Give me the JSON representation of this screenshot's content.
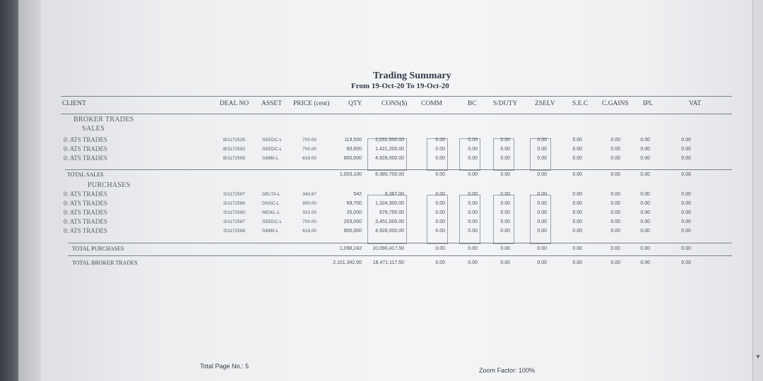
{
  "report": {
    "title": "Trading Summary",
    "subtitle": "From  19-Oct-20    To  19-Oct-20"
  },
  "columns": [
    "CLIENT",
    "DEAL NO",
    "ASSET",
    "PRICE (cent)",
    "QTY",
    "CONS($)",
    "COMM",
    "BC",
    "S/DUTY",
    "ZSELV",
    "S.E.C",
    "C.GAINS",
    "IPL",
    "VAT"
  ],
  "sections": {
    "broker": "BROKER TRADES",
    "sales": "SALES",
    "purchases": "PURCHASES",
    "total_sales": "TOTAL SALES",
    "total_purchases": "TOTAL PURCHASES",
    "total_broker": "TOTAL BROKER TRADES"
  },
  "sales_rows": [
    {
      "client": "0: ATS TRADES",
      "deal": "B/1172535",
      "asset": "SEEDC-L",
      "price": "700.00",
      "qty": "119,500",
      "cons": "2,031,500.00",
      "comm": "0.00",
      "bc": "0.00",
      "duty": "0.00",
      "zselv": "0.00",
      "sec": "0.00",
      "cg": "0.00",
      "ipl": "0.00",
      "vat": "0.00"
    },
    {
      "client": "0: ATS TRADES",
      "deal": "B/1172593",
      "asset": "SEEDC-L",
      "price": "700.00",
      "qty": "83,600",
      "cons": "1,421,200.00",
      "comm": "0.00",
      "bc": "0.00",
      "duty": "0.00",
      "zselv": "0.00",
      "sec": "0.00",
      "cg": "0.00",
      "ipl": "0.00",
      "vat": "0.00"
    },
    {
      "client": "0: ATS TRADES",
      "deal": "B/1172595",
      "asset": "SIMBI-L",
      "price": "616.00",
      "qty": "800,000",
      "cons": "4,928,000.00",
      "comm": "0.00",
      "bc": "0.00",
      "duty": "0.00",
      "zselv": "0.00",
      "sec": "0.00",
      "cg": "0.00",
      "ipl": "0.00",
      "vat": "0.00"
    }
  ],
  "total_sales_row": {
    "qty": "1,003,100",
    "cons": "8,380,700.00",
    "comm": "0.00",
    "bc": "0.00",
    "duty": "0.00",
    "zselv": "0.00",
    "sec": "0.00",
    "cg": "0.00",
    "ipl": "0.00",
    "vat": "0.00"
  },
  "purchase_rows": [
    {
      "client": "0: ATS TRADES",
      "deal": "S/1172597",
      "asset": "DELTA-L",
      "price": "343.87",
      "qty": "542",
      "cons": "8,367.00",
      "comm": "0.00",
      "bc": "0.00",
      "duty": "0.00",
      "zselv": "0.00",
      "sec": "0.00",
      "cg": "0.00",
      "ipl": "0.00",
      "vat": "0.00"
    },
    {
      "client": "0: ATS TRADES",
      "deal": "S/1172586",
      "asset": "DNSC-L",
      "price": "900.00",
      "qty": "69,700",
      "cons": "1,324,300.00",
      "comm": "0.00",
      "bc": "0.00",
      "duty": "0.00",
      "zselv": "0.00",
      "sec": "0.00",
      "cg": "0.00",
      "ipl": "0.00",
      "vat": "0.00"
    },
    {
      "client": "0: ATS TRADES",
      "deal": "S/1172590",
      "asset": "MEIKL-L",
      "price": "315.00",
      "qty": "25,000",
      "cons": "878,750.00",
      "comm": "0.00",
      "bc": "0.00",
      "duty": "0.00",
      "zselv": "0.00",
      "sec": "0.00",
      "cg": "0.00",
      "ipl": "0.00",
      "vat": "0.00"
    },
    {
      "client": "0: ATS TRADES",
      "deal": "S/1172587",
      "asset": "SEEDC-L",
      "price": "700.00",
      "qty": "203,000",
      "cons": "3,451,000.00",
      "comm": "0.00",
      "bc": "0.00",
      "duty": "0.00",
      "zselv": "0.00",
      "sec": "0.00",
      "cg": "0.00",
      "ipl": "0.00",
      "vat": "0.00"
    },
    {
      "client": "0: ATS TRADES",
      "deal": "S/1172588",
      "asset": "SIMBI-L",
      "price": "616.00",
      "qty": "800,000",
      "cons": "4,928,000.00",
      "comm": "0.00",
      "bc": "0.00",
      "duty": "0.00",
      "zselv": "0.00",
      "sec": "0.00",
      "cg": "0.00",
      "ipl": "0.00",
      "vat": "0.00"
    }
  ],
  "total_purchases_row": {
    "qty": "1,098,242",
    "cons": "10,090,417.50",
    "comm": "0.00",
    "bc": "0.00",
    "duty": "0.00",
    "zselv": "0.00",
    "sec": "0.00",
    "cg": "0.00",
    "ipl": "0.00",
    "vat": "0.00"
  },
  "total_broker_row": {
    "qty": "2,101,342.00",
    "cons": "18,471,117.50",
    "comm": "0.00",
    "bc": "0.00",
    "duty": "0.00",
    "zselv": "0.00",
    "sec": "0.00",
    "cg": "0.00",
    "ipl": "0.00",
    "vat": "0.00"
  },
  "status": {
    "page": "Total Page No.: 5",
    "zoom": "Zoom Factor: 100%"
  }
}
